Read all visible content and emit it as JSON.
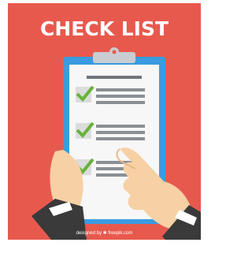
{
  "poster": {
    "title": "CHECK LIST",
    "credit": "designed by ✱ freepik.com"
  },
  "checklist": {
    "items": [
      {
        "checked": true
      },
      {
        "checked": true
      },
      {
        "checked": true
      }
    ]
  },
  "colors": {
    "background": "#e8594d",
    "clipboard_border": "#3b9be0",
    "paper": "#f7f7f7",
    "check": "#66b23a",
    "line": "#8a8f94",
    "hand": "#f7d0a5",
    "sleeve": "#3a3a3a"
  },
  "icons": [
    "clipboard-icon",
    "checkmark-icon",
    "hand-icon"
  ]
}
